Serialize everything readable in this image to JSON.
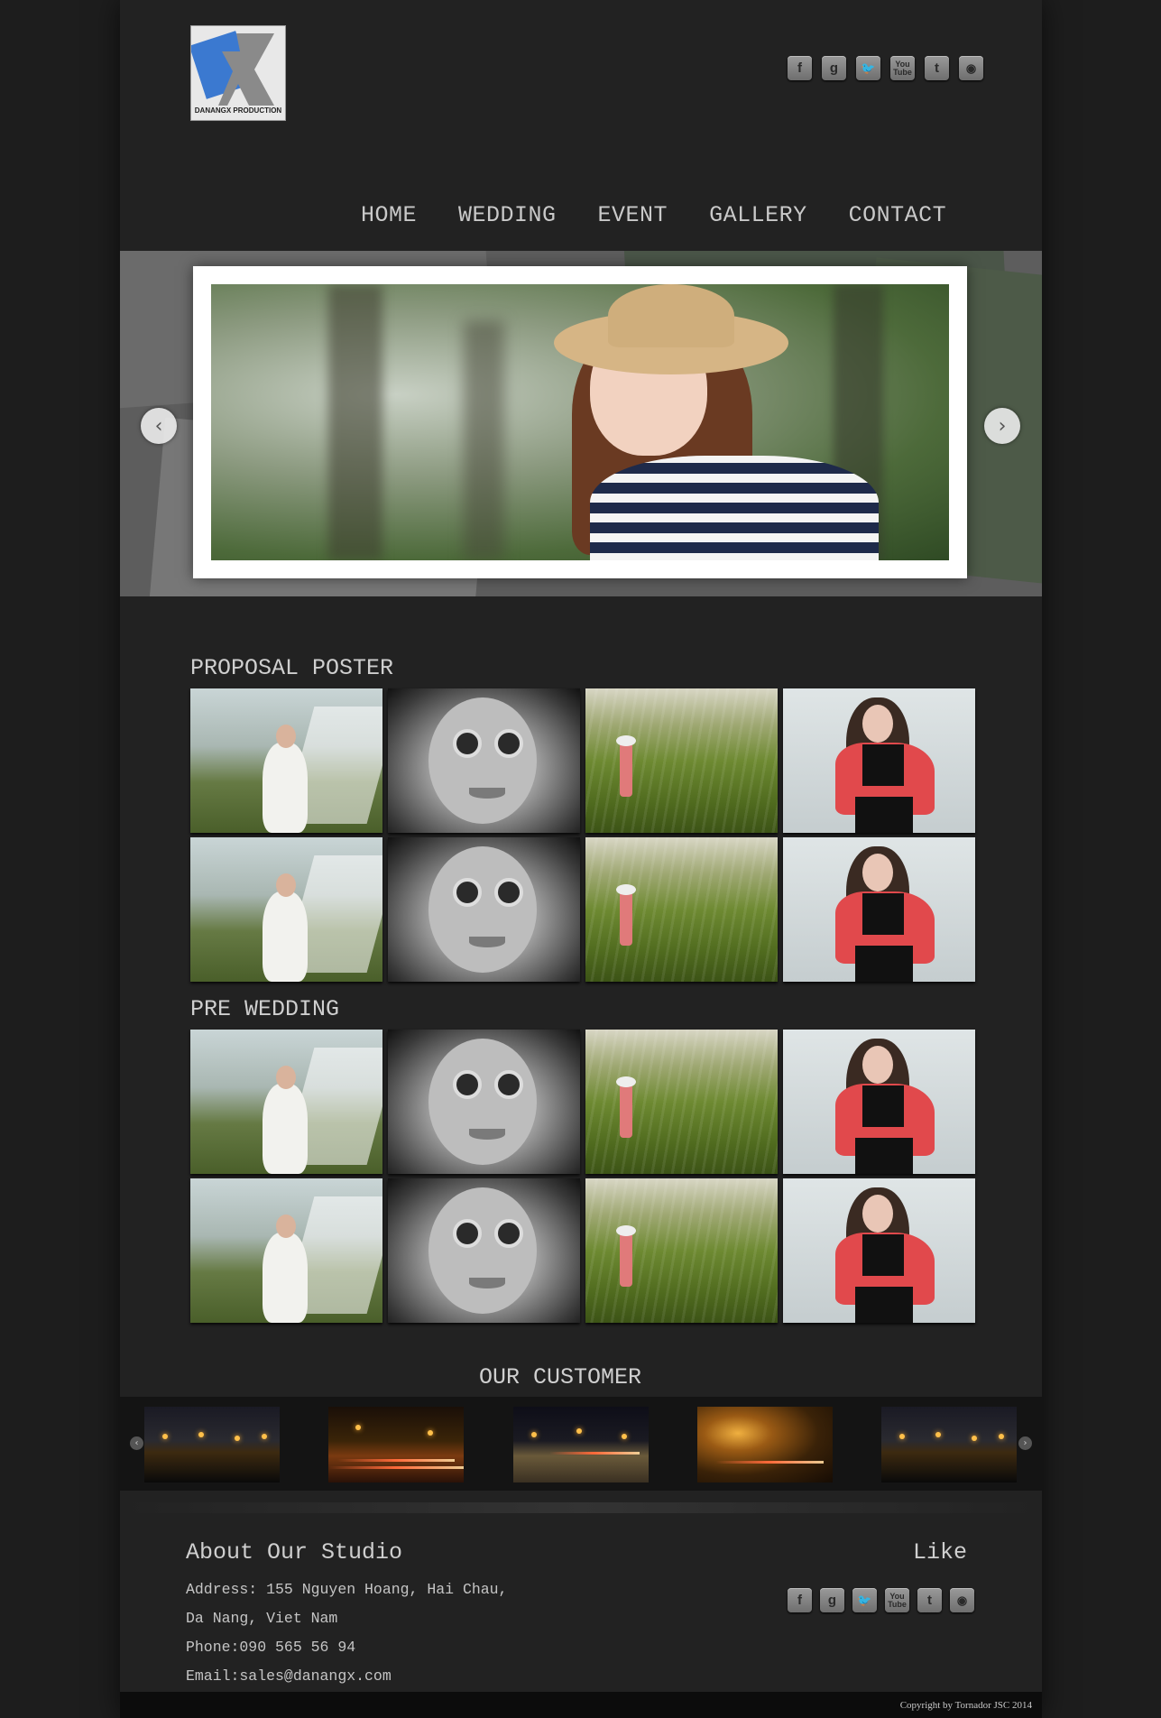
{
  "logo": {
    "text": "DANANGX PRODUCTION"
  },
  "social": [
    {
      "icon": "facebook-icon",
      "glyph": "f"
    },
    {
      "icon": "google-icon",
      "glyph": "g"
    },
    {
      "icon": "twitter-icon",
      "glyph": "🐦"
    },
    {
      "icon": "youtube-icon",
      "glyph": "You Tube"
    },
    {
      "icon": "tumblr-icon",
      "glyph": "t"
    },
    {
      "icon": "rss-icon",
      "glyph": "◉"
    }
  ],
  "nav": {
    "home": "HOME",
    "wedding": "WEDDING",
    "event": "EVENT",
    "gallery": "GALLERY",
    "contact": "CONTACT"
  },
  "slider": {
    "prev": "‹",
    "next": "›"
  },
  "sections": {
    "proposal_poster": "PROPOSAL POSTER",
    "pre_wedding": "PRE WEDDING",
    "our_customer": "OUR CUSTOMER"
  },
  "footer": {
    "about_title": "About Our Studio",
    "address_line1": "Address: 155 Nguyen Hoang, Hai Chau,",
    "address_line2": "Da Nang, Viet Nam",
    "phone": "Phone:090 565 56 94",
    "email": "Email:sales@danangx.com",
    "like_title": "Like",
    "copyright": "Copyright by Tornador JSC 2014"
  },
  "colors": {
    "background": "#1d1d1d",
    "page": "#222222",
    "text": "#cfcfcf"
  }
}
